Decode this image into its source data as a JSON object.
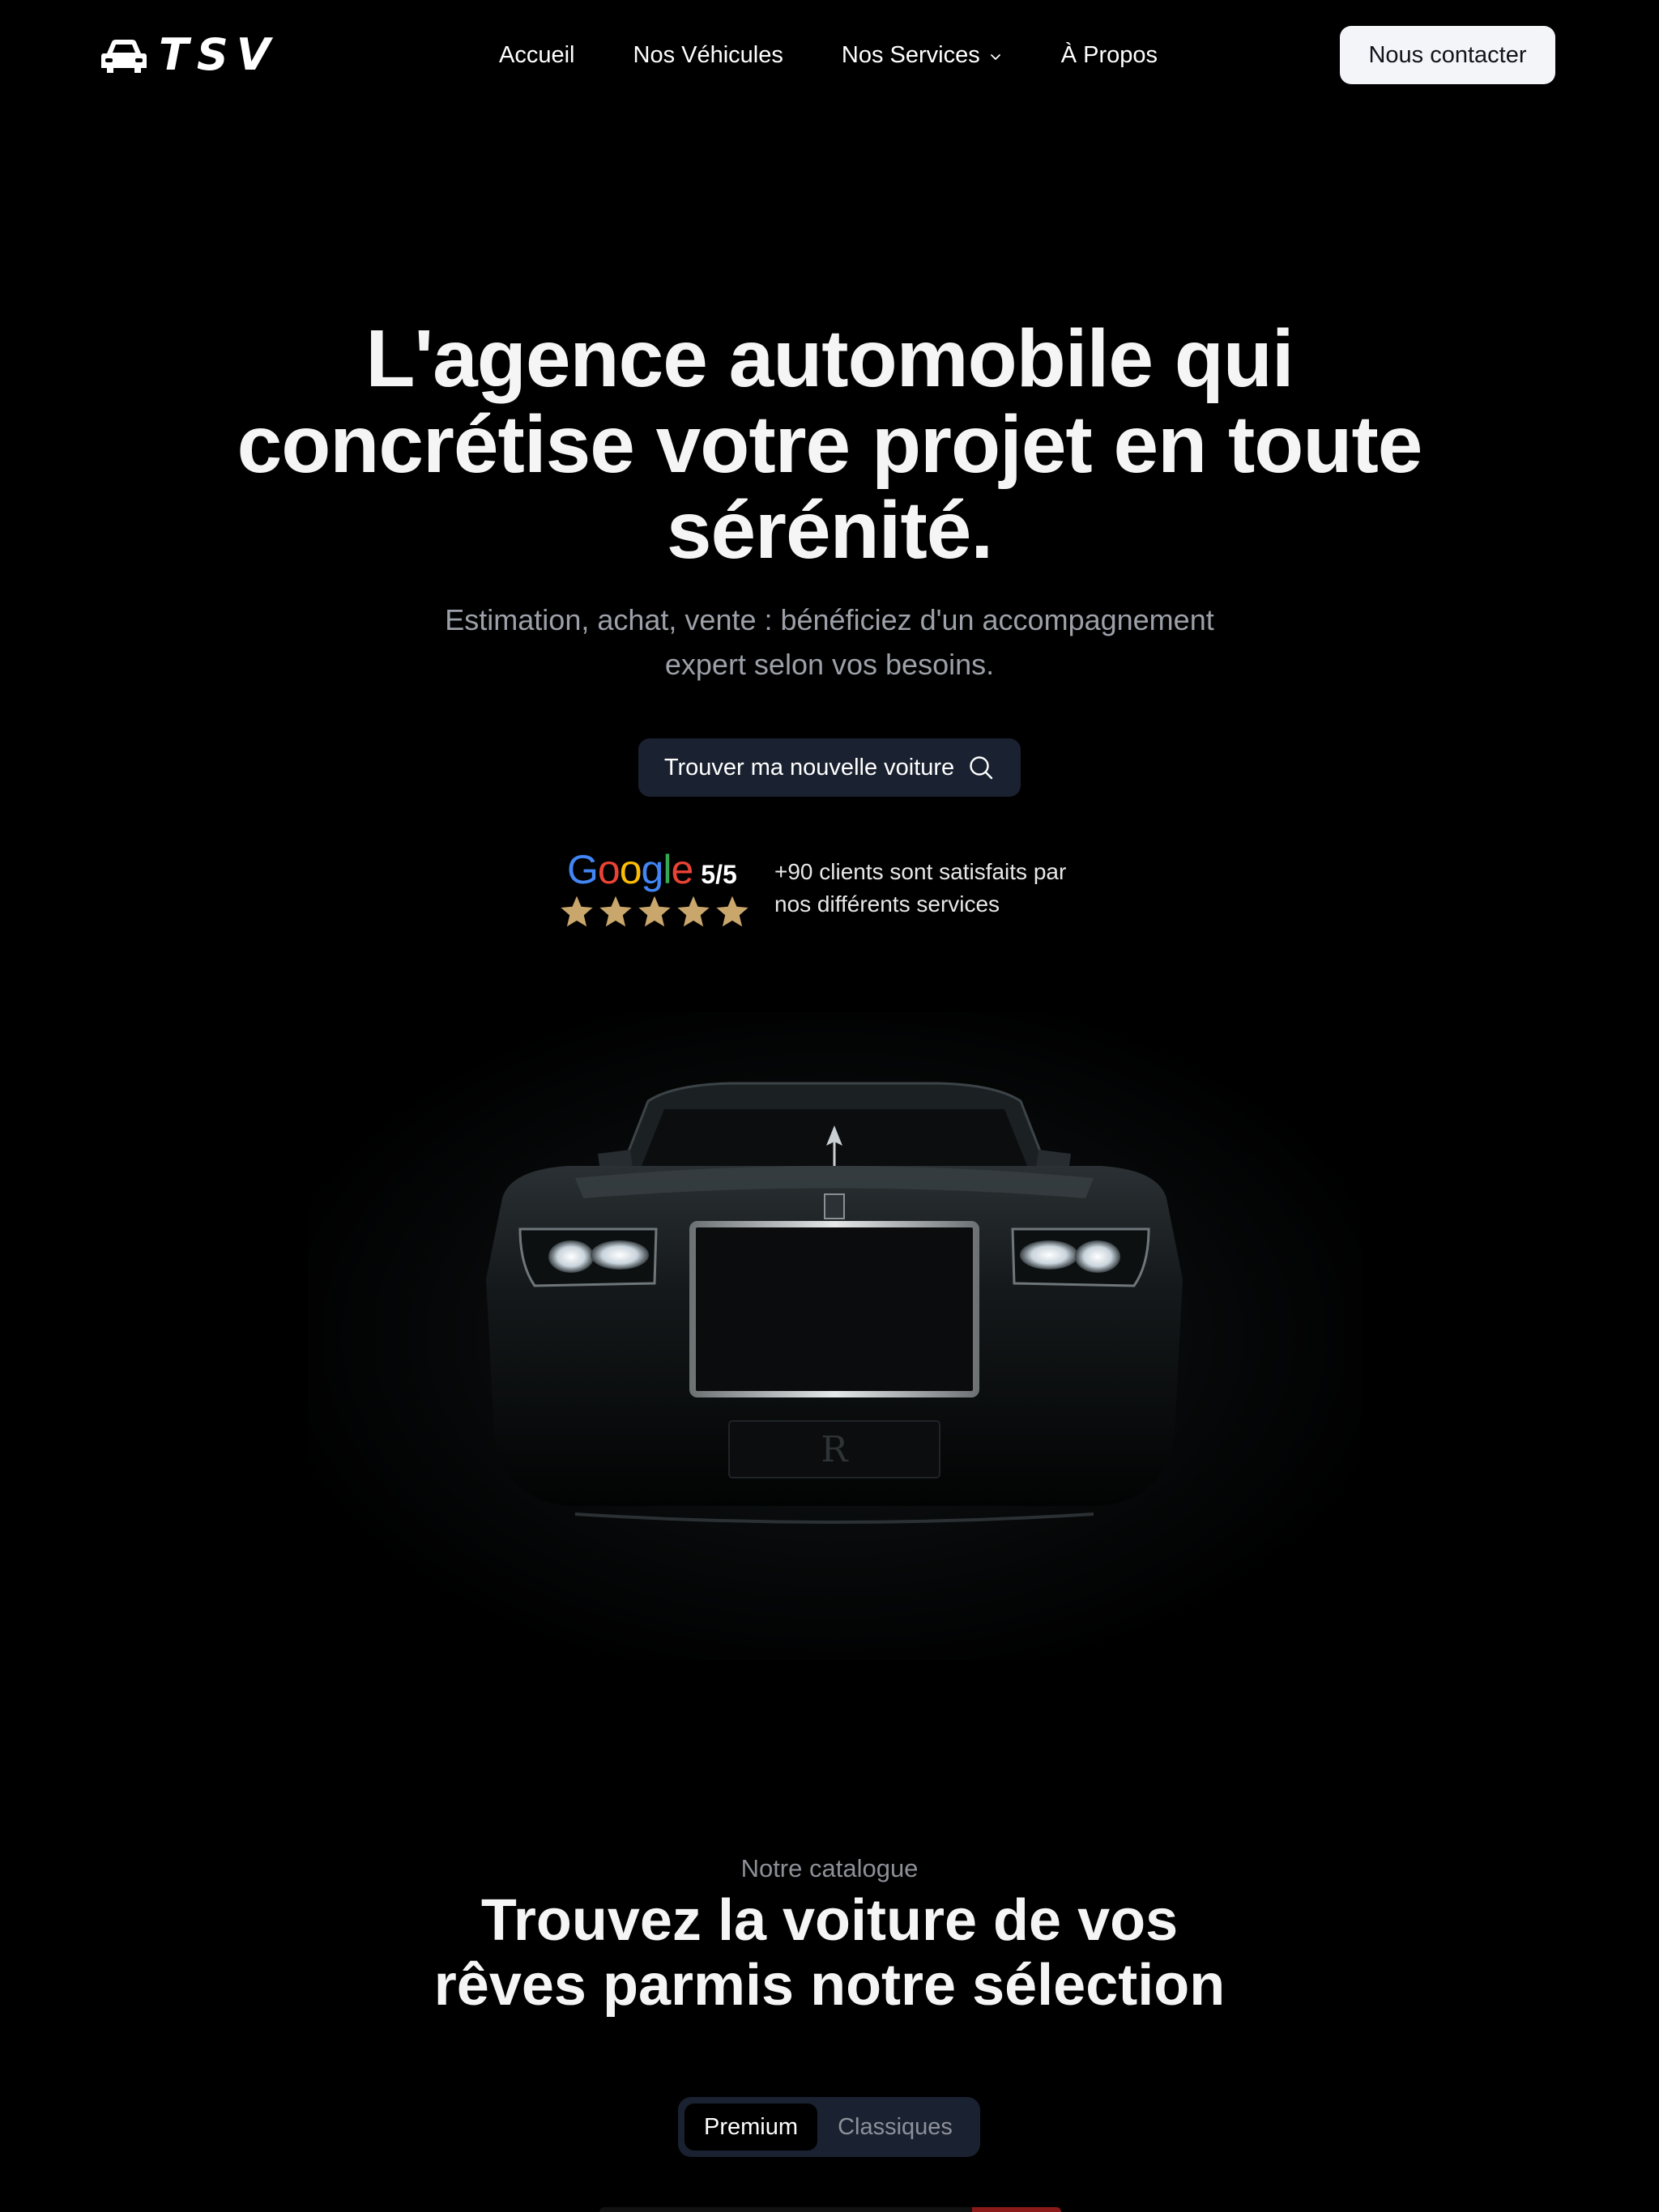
{
  "nav": {
    "logo_text": "TSV",
    "links": [
      {
        "label": "Accueil"
      },
      {
        "label": "Nos Véhicules"
      },
      {
        "label": "Nos Services"
      },
      {
        "label": "À Propos"
      }
    ],
    "contact_label": "Nous contacter"
  },
  "hero": {
    "title_line1": "L'agence automobile qui",
    "title_line2": "concrétise votre projet en toute",
    "title_line3": "sérénité.",
    "subtitle_line1": "Estimation, achat, vente : bénéficiez d'un accompagnement",
    "subtitle_line2": "expert selon vos besoins.",
    "cta_label": "Trouver ma nouvelle voiture",
    "cta_icon": "search-icon"
  },
  "rating": {
    "provider": "Google",
    "score": "5/5",
    "stars": 5,
    "text_line1": "+90 clients sont satisfaits par",
    "text_line2": "nos différents services",
    "star_color": "#c9a66b"
  },
  "catalogue": {
    "eyebrow": "Notre catalogue",
    "title_line1": "Trouvez la voiture de vos",
    "title_line2": "rêves parmis notre sélection",
    "tabs": [
      {
        "label": "Premium",
        "active": true
      },
      {
        "label": "Classiques",
        "active": false
      }
    ]
  },
  "colors": {
    "background": "#000000",
    "cta_bg": "#1a2130",
    "contact_bg": "#f3f5f9"
  }
}
